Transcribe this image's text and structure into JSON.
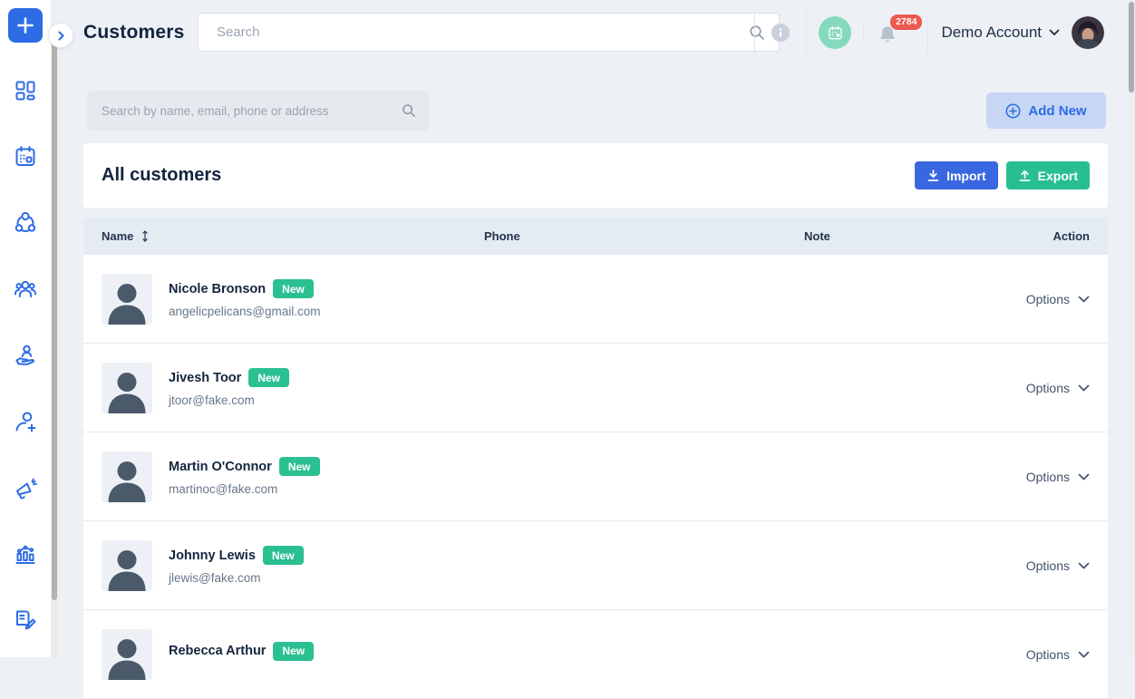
{
  "app": {
    "page_title": "Customers",
    "logo_icon": "plus-icon"
  },
  "topbar": {
    "search_placeholder": "Search",
    "notification_count": "2784",
    "account_label": "Demo Account",
    "icons": [
      "search-icon",
      "info-icon",
      "booking-icon",
      "bell-icon",
      "chevron-down-icon"
    ]
  },
  "sidebar": {
    "items": [
      {
        "id": "dashboard",
        "icon": "dashboard-icon"
      },
      {
        "id": "calendar",
        "icon": "calendar-icon"
      },
      {
        "id": "connections",
        "icon": "connections-icon"
      },
      {
        "id": "customers",
        "icon": "customers-icon"
      },
      {
        "id": "client-care",
        "icon": "hand-person-icon"
      },
      {
        "id": "add-customer",
        "icon": "person-add-icon"
      },
      {
        "id": "marketing",
        "icon": "megaphone-icon"
      },
      {
        "id": "reports",
        "icon": "bar-chart-icon"
      },
      {
        "id": "notes",
        "icon": "notebook-pencil-icon"
      }
    ]
  },
  "toolbar": {
    "search_placeholder": "Search by name, email, phone or address",
    "add_new_label": "Add New"
  },
  "list_header": {
    "title": "All customers",
    "import_label": "Import",
    "export_label": "Export"
  },
  "table": {
    "columns": [
      "Name",
      "Phone",
      "Note",
      "Action"
    ],
    "options_label": "Options",
    "rows": [
      {
        "name": "Nicole Bronson",
        "badge": "New",
        "email": "angelicpelicans@gmail.com",
        "phone": "",
        "note": ""
      },
      {
        "name": "Jivesh Toor",
        "badge": "New",
        "email": "jtoor@fake.com",
        "phone": "",
        "note": ""
      },
      {
        "name": "Martin O'Connor",
        "badge": "New",
        "email": "martinoc@fake.com",
        "phone": "",
        "note": ""
      },
      {
        "name": "Johnny Lewis",
        "badge": "New",
        "email": "jlewis@fake.com",
        "phone": "",
        "note": ""
      },
      {
        "name": "Rebecca Arthur",
        "badge": "New",
        "email": "",
        "phone": "",
        "note": ""
      }
    ]
  },
  "colors": {
    "brand_blue": "#2d6ce5",
    "add_new_bg": "#c6d6f4",
    "import_blue": "#3867df",
    "export_green": "#27bf92",
    "badge_green": "#2bc092",
    "notification_red": "#ee5a52",
    "booking_green": "#85d9bd",
    "page_bg": "#edf1f6",
    "table_header_bg": "#e4ebf3",
    "text_dark": "#14243e",
    "text_muted": "#68778a"
  }
}
